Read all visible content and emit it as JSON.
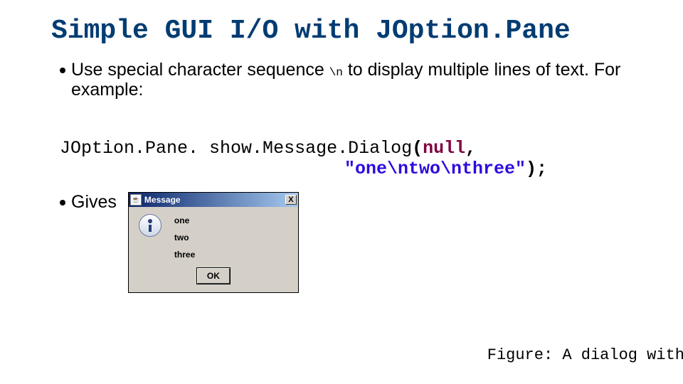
{
  "title": "Simple GUI I/O with JOption.Pane",
  "bullet1_prefix": "Use special character sequence ",
  "escape_seq": "\\n",
  "bullet1_suffix": " to display multiple lines of text. For example:",
  "code": {
    "call": "JOption.Pane. show.Message.Dialog",
    "open_paren": "(",
    "null_kw": "null",
    "comma": ",",
    "string_literal": "\"one\\ntwo\\nthree\"",
    "close": ");"
  },
  "gives_label": "Gives",
  "dialog": {
    "java_icon": "☕",
    "title": "Message",
    "close_glyph": "X",
    "lines": [
      "one",
      "two",
      "three"
    ],
    "ok_label": "OK"
  },
  "figure_caption": "Figure: A dialog with"
}
